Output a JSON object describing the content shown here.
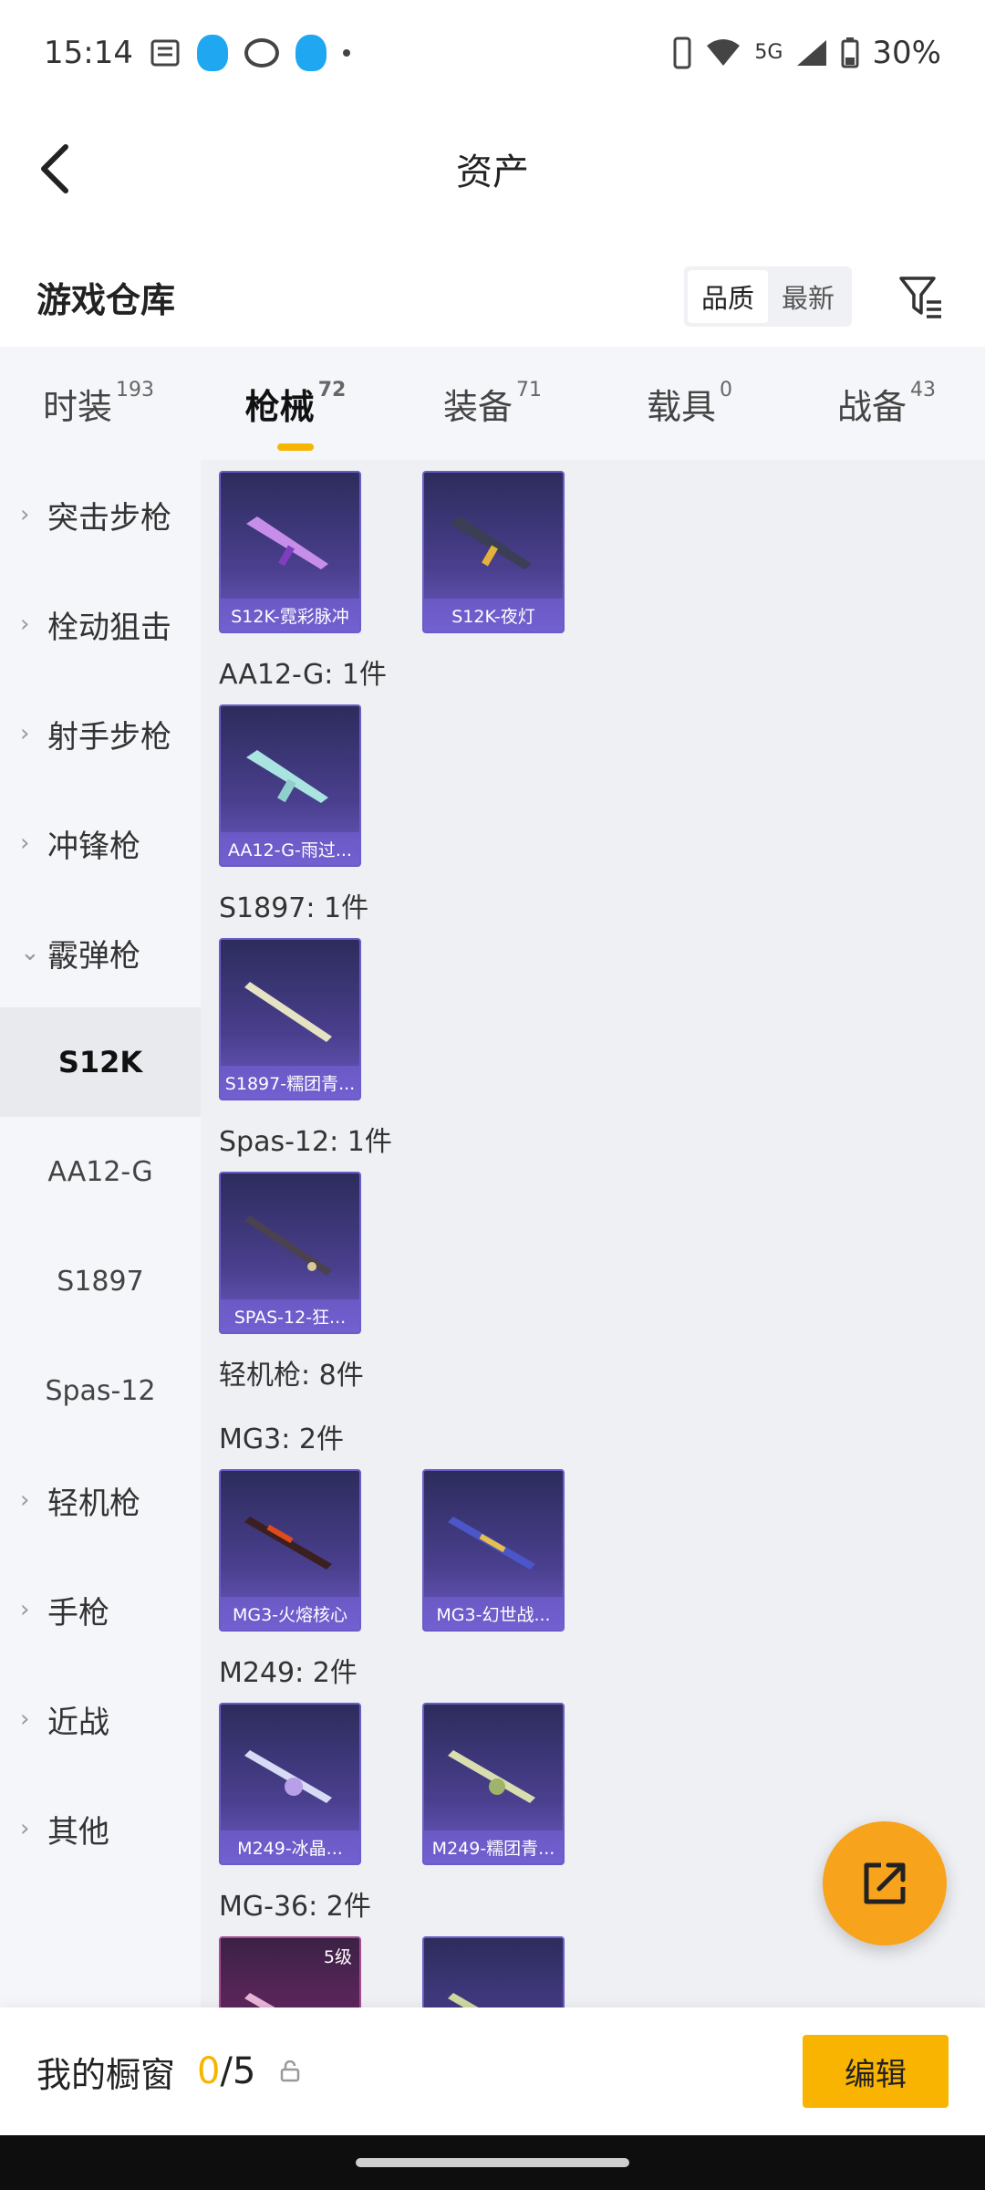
{
  "status_bar": {
    "time": "15:14",
    "network": "5G",
    "battery": "30%"
  },
  "header": {
    "title": "资产"
  },
  "warehouse": {
    "title": "游戏仓库",
    "sort_options": [
      "品质",
      "最新"
    ],
    "active_sort": "品质"
  },
  "tabs": [
    {
      "label": "时装",
      "count": "193"
    },
    {
      "label": "枪械",
      "count": "72",
      "active": true
    },
    {
      "label": "装备",
      "count": "71"
    },
    {
      "label": "载具",
      "count": "0"
    },
    {
      "label": "战备",
      "count": "43"
    }
  ],
  "sidebar": {
    "items": [
      {
        "label": "突击步枪"
      },
      {
        "label": "栓动狙击"
      },
      {
        "label": "射手步枪"
      },
      {
        "label": "冲锋枪"
      },
      {
        "label": "霰弹枪",
        "expanded": true
      }
    ],
    "sub_items": [
      {
        "label": "S12K",
        "active": true
      },
      {
        "label": "AA12-G"
      },
      {
        "label": "S1897"
      },
      {
        "label": "Spas-12"
      }
    ],
    "items_after": [
      {
        "label": "轻机枪"
      },
      {
        "label": "手枪"
      },
      {
        "label": "近战"
      },
      {
        "label": "其他"
      }
    ]
  },
  "content": {
    "groups": [
      {
        "label": "",
        "cards": [
          {
            "name": "S12K-霓彩脉冲"
          },
          {
            "name": "S12K-夜灯"
          }
        ]
      },
      {
        "label": "AA12-G: 1件",
        "cards": [
          {
            "name": "AA12-G-雨过..."
          }
        ]
      },
      {
        "label": "S1897: 1件",
        "cards": [
          {
            "name": "S1897-糯团青..."
          }
        ]
      },
      {
        "label": "Spas-12: 1件",
        "cards": [
          {
            "name": "SPAS-12-狂..."
          }
        ]
      },
      {
        "label": "轻机枪: 8件",
        "cards": []
      },
      {
        "label": "MG3: 2件",
        "cards": [
          {
            "name": "MG3-火熔核心"
          },
          {
            "name": "MG3-幻世战..."
          }
        ]
      },
      {
        "label": "M249: 2件",
        "cards": [
          {
            "name": "M249-冰晶..."
          },
          {
            "name": "M249-糯团青..."
          }
        ]
      },
      {
        "label": "MG-36: 2件",
        "cards": [
          {
            "name": "",
            "level": "5级"
          },
          {
            "name": ""
          }
        ]
      }
    ]
  },
  "bottom_bar": {
    "label": "我的橱窗",
    "current": "0",
    "total": "/5",
    "edit_label": "编辑"
  },
  "colors": {
    "accent": "#f7b500",
    "fab": "#f8a31c",
    "card": "#4a3f8e"
  },
  "icons": {
    "back": "chevron-left-icon",
    "filter": "filter-icon",
    "share": "share-external-icon",
    "lock": "lock-icon"
  }
}
